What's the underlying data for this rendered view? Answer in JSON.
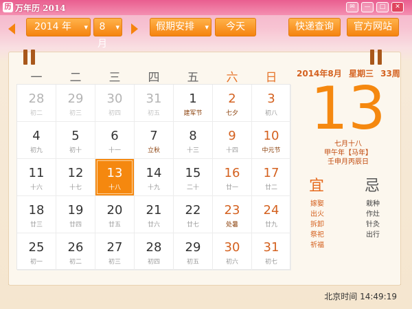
{
  "title_bar": {
    "title": "万年历 2014",
    "controls": [
      "✉",
      "—",
      "□",
      "✕"
    ]
  },
  "toolbar": {
    "year": "2014 年",
    "month": "8 月",
    "holiday_button": "假期安排",
    "today_button": "今天",
    "express_button": "快递查询",
    "website_button": "官方网站",
    "caret": "▾"
  },
  "weekdays": [
    "一",
    "二",
    "三",
    "四",
    "五",
    "六",
    "日"
  ],
  "weeks": [
    [
      {
        "day": "28",
        "lunar": "初二",
        "state": "other"
      },
      {
        "day": "29",
        "lunar": "初三",
        "state": "other"
      },
      {
        "day": "30",
        "lunar": "初四",
        "state": "other"
      },
      {
        "day": "31",
        "lunar": "初五",
        "state": "other"
      },
      {
        "day": "1",
        "lunar": "建军节",
        "state": "festival"
      },
      {
        "day": "2",
        "lunar": "七夕",
        "state": "weekend festival"
      },
      {
        "day": "3",
        "lunar": "初八",
        "state": "weekend"
      }
    ],
    [
      {
        "day": "4",
        "lunar": "初九",
        "state": ""
      },
      {
        "day": "5",
        "lunar": "初十",
        "state": ""
      },
      {
        "day": "6",
        "lunar": "十一",
        "state": ""
      },
      {
        "day": "7",
        "lunar": "立秋",
        "state": "festival"
      },
      {
        "day": "8",
        "lunar": "十三",
        "state": ""
      },
      {
        "day": "9",
        "lunar": "十四",
        "state": "weekend"
      },
      {
        "day": "10",
        "lunar": "中元节",
        "state": "weekend festival"
      }
    ],
    [
      {
        "day": "11",
        "lunar": "十六",
        "state": ""
      },
      {
        "day": "12",
        "lunar": "十七",
        "state": ""
      },
      {
        "day": "13",
        "lunar": "十八",
        "state": "today"
      },
      {
        "day": "14",
        "lunar": "十九",
        "state": ""
      },
      {
        "day": "15",
        "lunar": "二十",
        "state": ""
      },
      {
        "day": "16",
        "lunar": "廿一",
        "state": "weekend"
      },
      {
        "day": "17",
        "lunar": "廿二",
        "state": "weekend"
      }
    ],
    [
      {
        "day": "18",
        "lunar": "廿三",
        "state": ""
      },
      {
        "day": "19",
        "lunar": "廿四",
        "state": ""
      },
      {
        "day": "20",
        "lunar": "廿五",
        "state": ""
      },
      {
        "day": "21",
        "lunar": "廿六",
        "state": ""
      },
      {
        "day": "22",
        "lunar": "廿七",
        "state": ""
      },
      {
        "day": "23",
        "lunar": "处暑",
        "state": "weekend festival"
      },
      {
        "day": "24",
        "lunar": "廿九",
        "state": "weekend"
      }
    ],
    [
      {
        "day": "25",
        "lunar": "初一",
        "state": ""
      },
      {
        "day": "26",
        "lunar": "初二",
        "state": ""
      },
      {
        "day": "27",
        "lunar": "初三",
        "state": ""
      },
      {
        "day": "28",
        "lunar": "初四",
        "state": ""
      },
      {
        "day": "29",
        "lunar": "初五",
        "state": ""
      },
      {
        "day": "30",
        "lunar": "初六",
        "state": "weekend"
      },
      {
        "day": "31",
        "lunar": "初七",
        "state": "weekend"
      }
    ]
  ],
  "info": {
    "date_line": "2014年8月",
    "weekday_line": "星期三",
    "week_number": "33周",
    "big_day": "13",
    "lunar_date": "七月十八",
    "ganzhi_year": "甲午年【马年】",
    "ganzhi_day": "壬申月丙辰日",
    "yi_label": "宜",
    "ji_label": "忌",
    "yi_items": [
      "嫁娶",
      "出火",
      "拆卸",
      "祭祀",
      "祈福"
    ],
    "ji_items": [
      "栽种",
      "作灶",
      "针灸",
      "出行"
    ]
  },
  "status": {
    "label": "北京时间",
    "time": "14:49:19"
  },
  "colors": {
    "accent": "#f5880f",
    "weekend": "#d4611f",
    "title_bar": "#e95e8f"
  }
}
